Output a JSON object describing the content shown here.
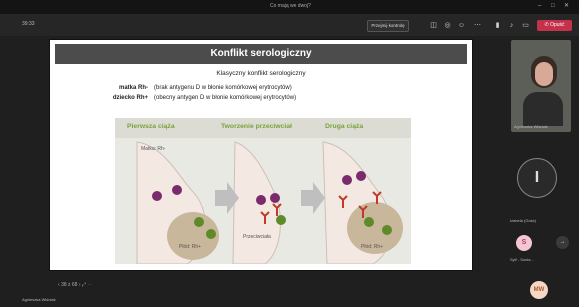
{
  "window": {
    "title": "Co mają we dwoj?"
  },
  "callbar": {
    "timer": "39:33",
    "share_label": "Przejmij kontrolę",
    "leave_label": "Opuść"
  },
  "slide": {
    "title": "Konflikt serologiczny",
    "subtitle": "Klasyczny konflikt serologiczny",
    "rows": [
      {
        "term": "matka Rh-",
        "desc": "(brak antygenu D w błonie komórkowej erytrocytów)"
      },
      {
        "term": "dziecko Rh+",
        "desc": "(obecny antygen D w błonie komórkowej erytrocytów)"
      }
    ],
    "figure": {
      "headers": [
        "Pierwsza ciąża",
        "Tworzenie przeciwciał",
        "Druga ciąża"
      ],
      "labels": {
        "mother": "Matka: Rh-",
        "fetus1": "Płód: Rh+",
        "antibodies": "Przeciwciała",
        "fetus2": "Płód: Rh+"
      }
    }
  },
  "slide_nav": {
    "page": "38 z 68"
  },
  "participants": {
    "presenter_name": "Agnieszka Wiśniak",
    "video_name": "Agnieszka Wiśniak",
    "large_avatar_initial": "I",
    "large_avatar_name": "Izabela (Gość)",
    "small_avatar_initial": "S",
    "small_avatar_name": "Sylf - Sonia...",
    "bottom_avatar_initials": "MW"
  },
  "colors": {
    "accent_red": "#c4314b",
    "header_gray": "#4c4c4c",
    "figure_green": "#79a33a"
  }
}
